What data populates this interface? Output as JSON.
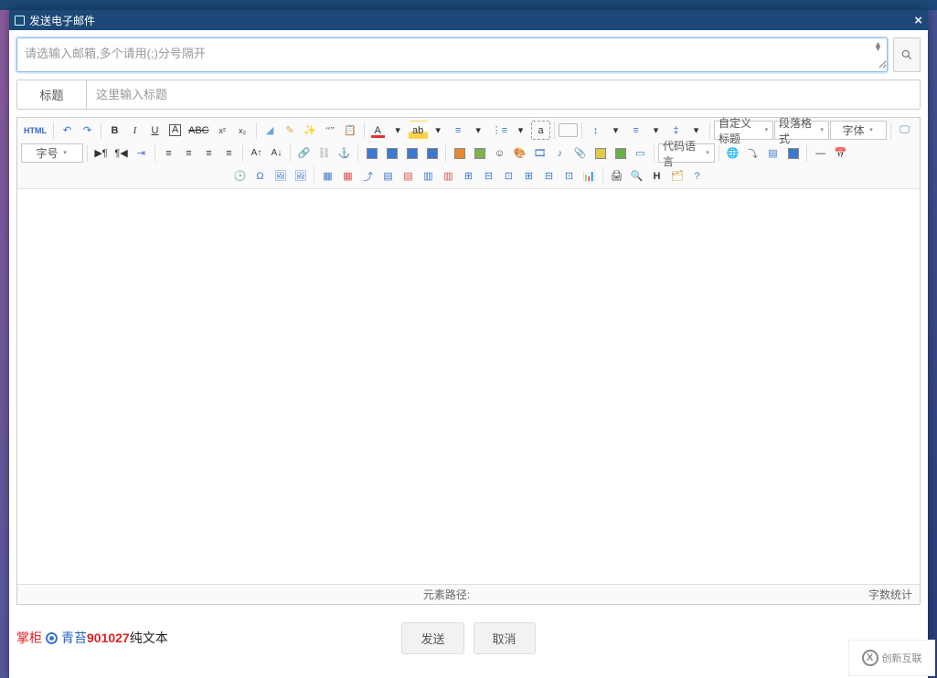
{
  "modal": {
    "title": "发送电子邮件",
    "close_tooltip": "关闭"
  },
  "recipients": {
    "placeholder": "请选输入邮箱,多个请用(;)分号隔开",
    "value": ""
  },
  "subject": {
    "label": "标题",
    "placeholder": "这里输入标题",
    "value": ""
  },
  "toolbar": {
    "html_btn": "HTML",
    "custom_title": "自定义标题",
    "paragraph_format": "段落格式",
    "font_family": "字体",
    "font_size": "字号",
    "code_lang": "代码语言"
  },
  "statusbar": {
    "path_label": "元素路径:",
    "word_count_label": "字数统计"
  },
  "footer": {
    "send": "发送",
    "cancel": "取消"
  },
  "overlay": {
    "left_red": "掌柜",
    "blue_text": "青苔",
    "red_number": "901027",
    "black_text": "纯文本"
  },
  "watermark": {
    "text": "创新互联"
  },
  "colors": {
    "titlebar": "#1d4877",
    "focus_border": "#8bbbe8",
    "danger": "#d22"
  }
}
